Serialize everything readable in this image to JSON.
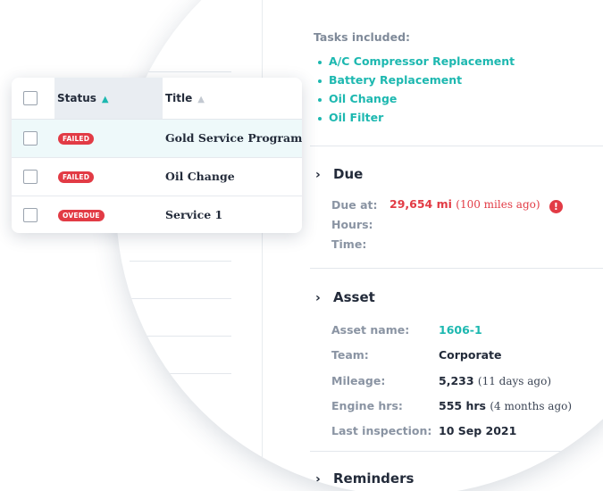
{
  "details": {
    "tasks_label": "Tasks included:",
    "tasks": [
      "A/C Compressor Replacement",
      "Battery Replacement",
      "Oil Change",
      "Oil Filter"
    ],
    "due": {
      "title": "Due",
      "due_at_label": "Due at:",
      "due_at_value": "29,654 mi",
      "due_at_sub": "(100 miles ago)",
      "hours_label": "Hours:",
      "time_label": "Time:"
    },
    "asset": {
      "title": "Asset",
      "rows": [
        {
          "label": "Asset name:",
          "value": "1606-1",
          "sub": ""
        },
        {
          "label": "Team:",
          "value": "Corporate",
          "sub": ""
        },
        {
          "label": "Mileage:",
          "value": "5,233",
          "sub": "(11 days ago)"
        },
        {
          "label": "Engine hrs:",
          "value": "555 hrs",
          "sub": "(4 months ago)"
        },
        {
          "label": "Last inspection:",
          "value": "10 Sep 2021",
          "sub": ""
        }
      ]
    },
    "reminders_title": "Reminders"
  },
  "table": {
    "columns": {
      "status": "Status",
      "title": "Title"
    },
    "rows": [
      {
        "status": "FAILED",
        "title": "Gold Service Program",
        "selected": true
      },
      {
        "status": "FAILED",
        "title": "Oil Change",
        "selected": false
      },
      {
        "status": "OVERDUE",
        "title": "Service 1",
        "selected": false
      }
    ]
  },
  "colors": {
    "accent": "#1db8b0",
    "danger": "#e23b45",
    "text": "#232b3a",
    "muted": "#8a94a3"
  },
  "icons": {
    "chevron": "chevron-right-icon",
    "alert": "exclamation-circle-icon",
    "sort": "sort-icon"
  }
}
